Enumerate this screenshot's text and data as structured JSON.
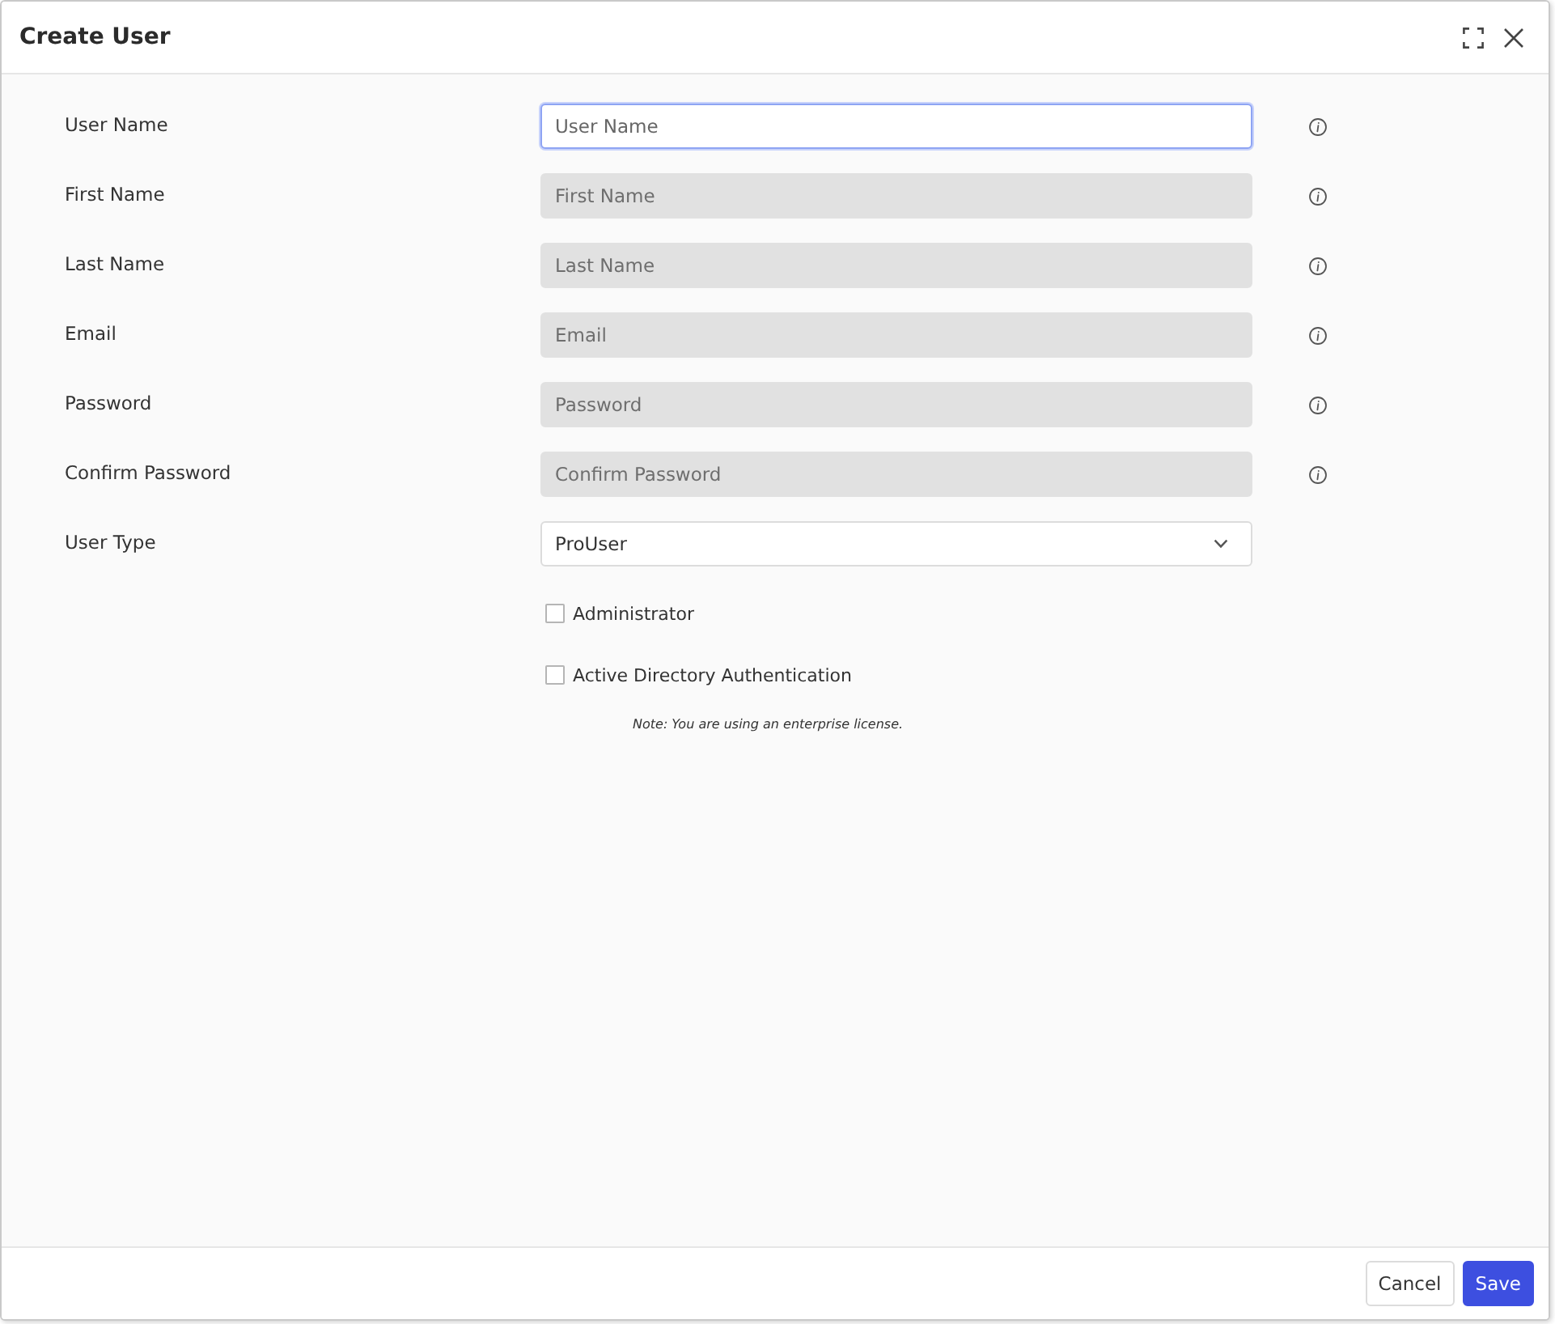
{
  "dialog": {
    "title": "Create User"
  },
  "fields": [
    {
      "label": "User Name",
      "placeholder": "User Name",
      "disabled": false,
      "focused": true
    },
    {
      "label": "First Name",
      "placeholder": "First Name",
      "disabled": true,
      "focused": false
    },
    {
      "label": "Last Name",
      "placeholder": "Last Name",
      "disabled": true,
      "focused": false
    },
    {
      "label": "Email",
      "placeholder": "Email",
      "disabled": true,
      "focused": false
    },
    {
      "label": "Password",
      "placeholder": "Password",
      "disabled": true,
      "focused": false
    },
    {
      "label": "Confirm Password",
      "placeholder": "Confirm Password",
      "disabled": true,
      "focused": false
    }
  ],
  "user_type": {
    "label": "User Type",
    "value": "ProUser"
  },
  "options": [
    {
      "label": "Administrator",
      "checked": false
    },
    {
      "label": "Active Directory Authentication",
      "checked": false
    }
  ],
  "note": "Note: You are using an enterprise license.",
  "buttons": [
    {
      "label": "Cancel",
      "kind": "secondary"
    },
    {
      "label": "Save",
      "kind": "primary"
    }
  ]
}
